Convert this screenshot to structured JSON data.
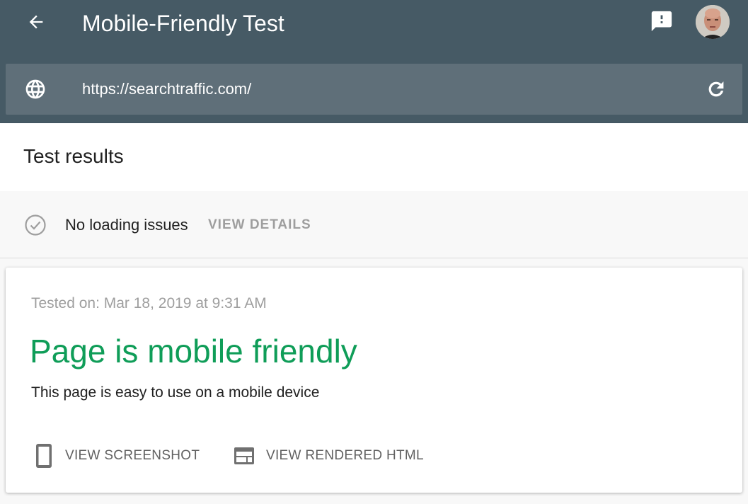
{
  "app_bar": {
    "title": "Mobile-Friendly Test",
    "back_icon": "arrow-back-icon",
    "feedback_icon": "feedback-icon",
    "avatar_alt": "account-avatar"
  },
  "url_bar": {
    "icon": "globe-icon",
    "value": "https://searchtraffic.com/",
    "refresh_icon": "refresh-icon"
  },
  "results": {
    "title": "Test results"
  },
  "loading": {
    "icon": "check-circle-icon",
    "status": "No loading issues",
    "view_details_label": "VIEW DETAILS"
  },
  "card": {
    "tested_on": "Tested on: Mar 18, 2019 at 9:31 AM",
    "verdict": "Page is mobile friendly",
    "verdict_color": "#0f9d58",
    "subtitle": "This page is easy to use on a mobile device",
    "actions": [
      {
        "label": "VIEW SCREENSHOT",
        "icon": "smartphone-icon"
      },
      {
        "label": "VIEW RENDERED HTML",
        "icon": "web-layout-icon"
      }
    ]
  },
  "colors": {
    "app_bar": "#465a65",
    "url_bar": "#5f6f79",
    "success": "#0f9d58"
  }
}
